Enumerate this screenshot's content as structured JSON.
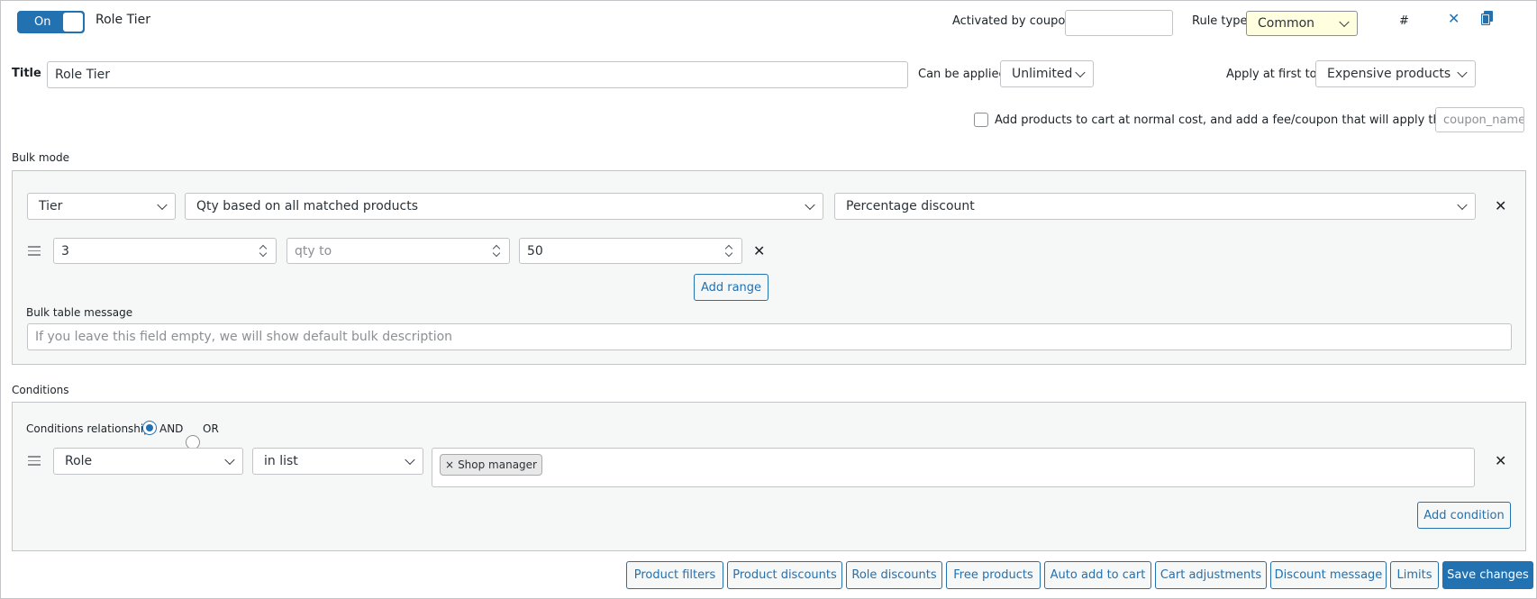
{
  "header": {
    "toggle_label": "On",
    "rule_name": "Role Tier",
    "activated_by_coupon_label": "Activated by coupon",
    "coupon_value": "",
    "rule_type_label": "Rule type",
    "rule_type_value": "Common",
    "hash_label": "#"
  },
  "title_row": {
    "title_label": "Title",
    "title_value": "Role Tier",
    "can_be_applied_label": "Can be applied",
    "can_be_applied_value": "Unlimited",
    "apply_first_label": "Apply at first to:",
    "apply_first_value": "Expensive products"
  },
  "cart_option": {
    "label": "Add products to cart at normal cost, and add a fee/coupon that will apply that cost",
    "coupon_name_placeholder": "coupon_name"
  },
  "bulk": {
    "section_label": "Bulk mode",
    "mode_value": "Tier",
    "qty_basis_value": "Qty based on all matched products",
    "discount_type_value": "Percentage discount",
    "range": {
      "from_value": "3",
      "to_placeholder": "qty to",
      "discount_value": "50"
    },
    "add_range_label": "Add range",
    "message_label": "Bulk table message",
    "message_placeholder": "If you leave this field empty, we will show default bulk description"
  },
  "conditions": {
    "section_label": "Conditions",
    "relationship_label": "Conditions relationship",
    "and_label": "AND",
    "or_label": "OR",
    "selected_relationship": "AND",
    "condition": {
      "type_value": "Role",
      "operator_value": "in list",
      "tags": [
        "Shop manager"
      ],
      "tag_remove_glyph": "×"
    },
    "add_condition_label": "Add condition"
  },
  "footer_buttons": [
    "Product filters",
    "Product discounts",
    "Role discounts",
    "Free products",
    "Auto add to cart",
    "Cart adjustments",
    "Discount message",
    "Limits"
  ],
  "save_label": "Save changes",
  "colors": {
    "accent": "#2271b1",
    "rule_type_bg": "#ffffe0",
    "panel_bg": "#f6f7f7",
    "border": "#c3c4c7"
  }
}
